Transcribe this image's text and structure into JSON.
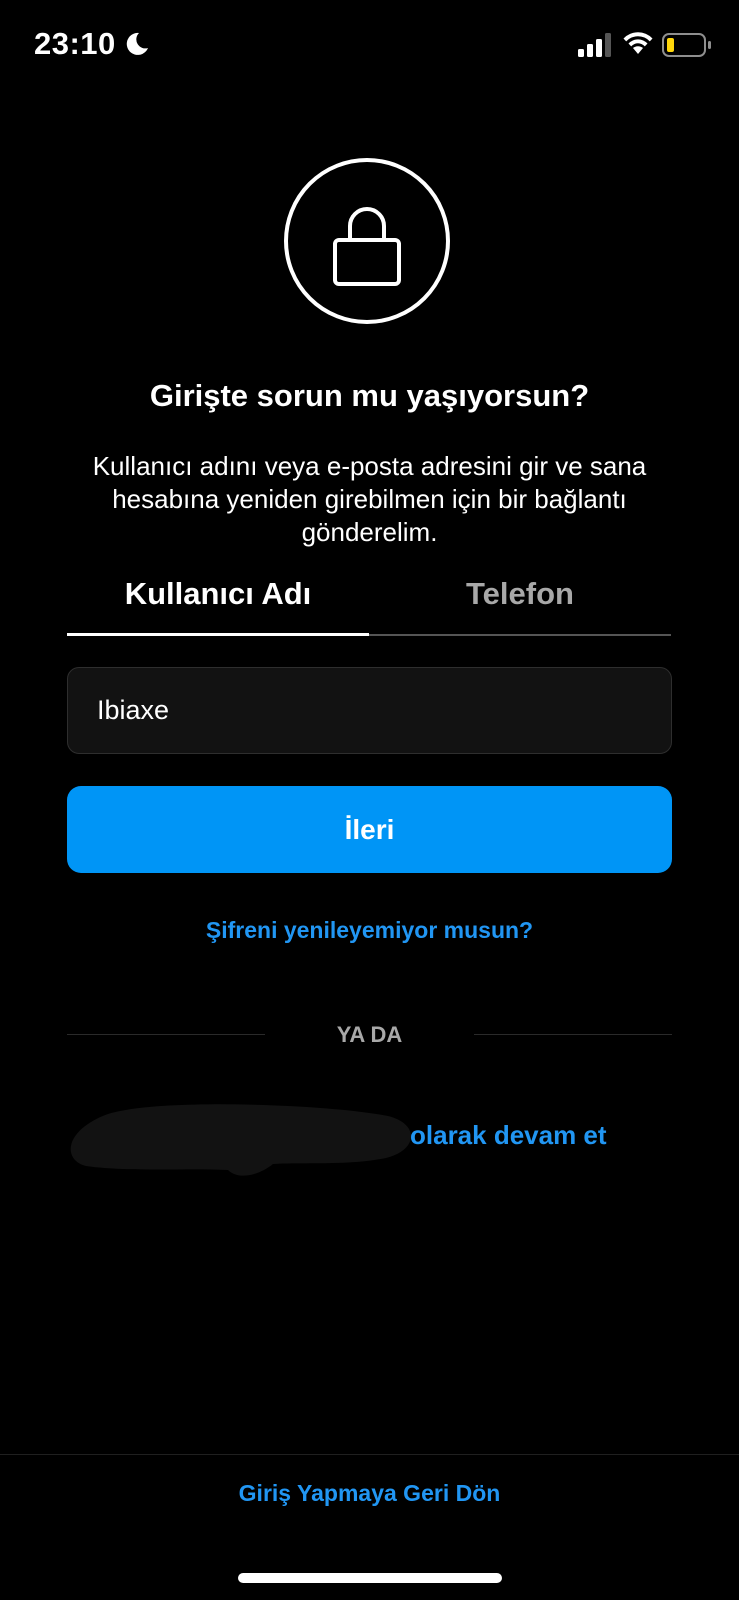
{
  "status_bar": {
    "time": "23:10",
    "moon_icon": "moon-icon",
    "signal_icon": "cellular-signal-icon",
    "wifi_icon": "wifi-icon",
    "battery_icon": "battery-low-icon",
    "battery_color": "#ffd60a"
  },
  "header": {
    "lock_icon": "lock-icon",
    "title": "Girişte sorun mu yaşıyorsun?",
    "description": "Kullanıcı adını veya e-posta adresini gir ve sana hesabına yeniden girebilmen için bir bağlantı gönderelim."
  },
  "tabs": [
    {
      "label": "Kullanıcı Adı",
      "active": true
    },
    {
      "label": "Telefon",
      "active": false
    }
  ],
  "form": {
    "username_value": "Ibiaxe",
    "next_label": "İleri",
    "accent_color": "#0095f6"
  },
  "links": {
    "cant_reset": "Şifreni yenileyemiyor musun?",
    "divider": "YA DA",
    "continue_as": "olarak devam et",
    "back_to_login": "Giriş Yapmaya Geri Dön"
  }
}
